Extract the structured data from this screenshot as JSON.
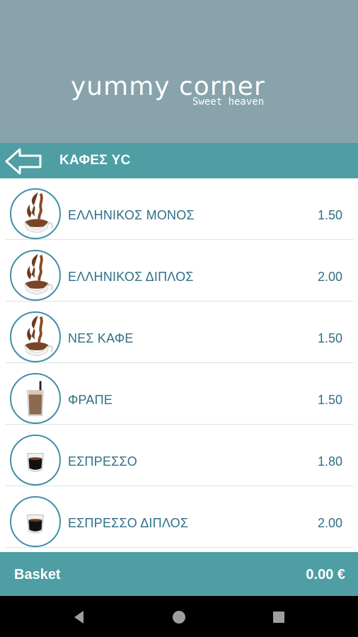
{
  "brand": {
    "logo_text": "yummy corner",
    "tagline": "Sweet heaven"
  },
  "titlebar": {
    "title": "ΚΑΦΕΣ YC",
    "back_icon": "arrow-left-icon"
  },
  "products": [
    {
      "name": "ΕΛΛΗΝΙΚΟΣ ΜΟΝΟΣ",
      "price": "1.50",
      "image": "greek-coffee-splash"
    },
    {
      "name": "ΕΛΛΗΝΙΚΟΣ ΔΙΠΛΟΣ",
      "price": "2.00",
      "image": "greek-coffee-splash"
    },
    {
      "name": "ΝΕΣ ΚΑΦΕ",
      "price": "1.50",
      "image": "coffee-splash"
    },
    {
      "name": "ΦΡΑΠΕ",
      "price": "1.50",
      "image": "frappe-glass"
    },
    {
      "name": "ΕΣΠΡΕΣΣΟ",
      "price": "1.80",
      "image": "espresso-glass"
    },
    {
      "name": "ΕΣΠΡΕΣΣΟ ΔΙΠΛΟΣ",
      "price": "2.00",
      "image": "espresso-glass"
    }
  ],
  "basket": {
    "label": "Basket",
    "total": "0.00 €"
  },
  "colors": {
    "header_bg": "#88a3ab",
    "accent": "#4e9ea4",
    "text": "#2f6f86"
  },
  "system_nav": [
    "back-triangle-icon",
    "home-circle-icon",
    "recents-square-icon"
  ]
}
